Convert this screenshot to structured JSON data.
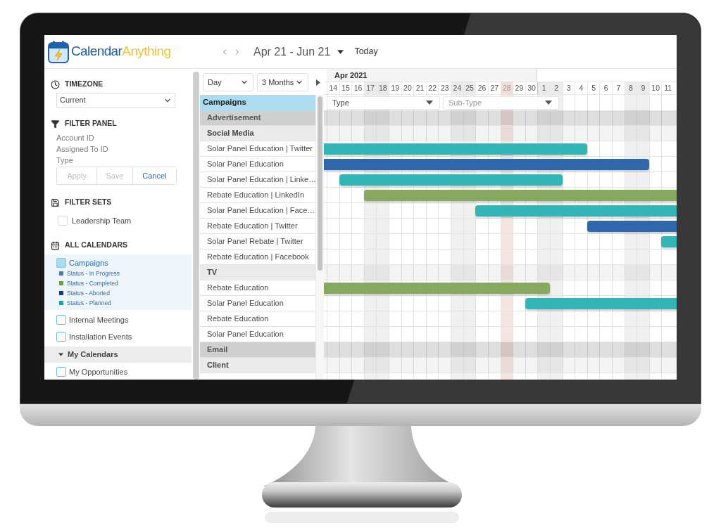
{
  "header": {
    "logo": [
      "Calendar",
      "Anything"
    ],
    "date_range": "Apr 21 - Jun 21",
    "today_button": "Today"
  },
  "sidebar": {
    "timezone": {
      "heading": "TIMEZONE",
      "value": "Current"
    },
    "filter_panel": {
      "heading": "FILTER PANEL",
      "fields": [
        "Account ID",
        "Assigned To ID",
        "Type"
      ],
      "buttons": [
        {
          "label": "Apply",
          "disabled": true
        },
        {
          "label": "Save",
          "disabled": true
        },
        {
          "label": "Cancel",
          "disabled": false
        }
      ]
    },
    "filter_sets": {
      "heading": "FILTER SETS",
      "items": [
        {
          "label": "Leadership Team",
          "checked": false
        }
      ]
    },
    "all_calendars": {
      "heading": "ALL CALENDARS",
      "items": [
        {
          "label": "Campaigns",
          "checked": true,
          "legend": [
            {
              "label": "Status - In Progress",
              "color": "#4b79b5"
            },
            {
              "label": "Status - Completed",
              "color": "#6f9a3f"
            },
            {
              "label": "Status - Aborted",
              "color": "#0e3d8a"
            },
            {
              "label": "Status - Planned",
              "color": "#16a5a5"
            }
          ]
        },
        {
          "label": "Internal Meetings",
          "checked": false
        },
        {
          "label": "Installation Events",
          "checked": false
        }
      ],
      "groups": [
        {
          "label": "My Calendars",
          "expanded": true,
          "items": [
            {
              "label": "My Opportunities",
              "checked": false
            }
          ]
        }
      ]
    }
  },
  "calendar_list": {
    "view": "Day",
    "range": "3 Months",
    "tree": {
      "label": "Campaigns",
      "children": [
        {
          "label": "Advertisement",
          "kind": "group",
          "children": [
            {
              "label": "Social Media",
              "kind": "group",
              "children": [
                {
                  "label": "Solar Panel Education | Twitter",
                  "kind": "campaign",
                  "bar": {
                    "color": "#33b5b6",
                    "continues_before": true,
                    "continues_after": false
                  }
                },
                {
                  "label": "Solar Panel Education",
                  "kind": "campaign",
                  "bar": {
                    "color": "#2f68aa",
                    "continues_before": true,
                    "continues_after": false
                  }
                },
                {
                  "label": "Solar Panel Education | Linke…",
                  "kind": "campaign",
                  "bar": {
                    "color": "#33b5b6",
                    "continues_before": false,
                    "continues_after": false
                  }
                },
                {
                  "label": "Rebate Education | LinkedIn",
                  "kind": "campaign",
                  "bar": {
                    "color": "#86a95f",
                    "continues_before": false,
                    "continues_after": true
                  }
                },
                {
                  "label": "Solar Panel Education | Face…",
                  "kind": "campaign",
                  "bar": {
                    "color": "#33b5b6",
                    "continues_before": false,
                    "continues_after": true
                  }
                },
                {
                  "label": "Rebate Education | Twitter",
                  "kind": "campaign",
                  "bar": {
                    "color": "#2f68aa",
                    "continues_before": false,
                    "continues_after": true
                  }
                },
                {
                  "label": "Solar Panel Rebate | Twitter",
                  "kind": "campaign",
                  "bar": {
                    "color": "#33b5b6",
                    "continues_before": false,
                    "continues_after": true
                  }
                },
                {
                  "label": "Rebate Education | Facebook",
                  "kind": "campaign"
                }
              ]
            },
            {
              "label": "TV",
              "kind": "group",
              "children": [
                {
                  "label": "Rebate Education",
                  "kind": "campaign",
                  "bar": {
                    "color": "#86a95f",
                    "continues_before": true,
                    "continues_after": false
                  }
                },
                {
                  "label": "Solar Panel Education",
                  "kind": "campaign",
                  "bar": {
                    "color": "#33b5b6",
                    "continues_before": false,
                    "continues_after": true
                  }
                },
                {
                  "label": "Rebate Education",
                  "kind": "campaign"
                },
                {
                  "label": "Solar Panel Education",
                  "kind": "campaign"
                }
              ]
            }
          ]
        },
        {
          "label": "Email",
          "kind": "group",
          "children": [
            {
              "label": "Client",
              "kind": "group"
            }
          ]
        }
      ]
    }
  },
  "gantt": {
    "month": "Apr 2021",
    "days": [
      {
        "label": "14",
        "weekend": false,
        "today": false,
        "month_start": false
      },
      {
        "label": "15",
        "weekend": false,
        "today": false,
        "month_start": false
      },
      {
        "label": "16",
        "weekend": false,
        "today": false,
        "month_start": false
      },
      {
        "label": "17",
        "weekend": true,
        "today": false,
        "month_start": false
      },
      {
        "label": "18",
        "weekend": true,
        "today": false,
        "month_start": false
      },
      {
        "label": "19",
        "weekend": false,
        "today": false,
        "month_start": false
      },
      {
        "label": "20",
        "weekend": false,
        "today": false,
        "month_start": false
      },
      {
        "label": "21",
        "weekend": false,
        "today": false,
        "month_start": false
      },
      {
        "label": "22",
        "weekend": false,
        "today": false,
        "month_start": false
      },
      {
        "label": "23",
        "weekend": false,
        "today": false,
        "month_start": false
      },
      {
        "label": "24",
        "weekend": true,
        "today": false,
        "month_start": false
      },
      {
        "label": "25",
        "weekend": true,
        "today": false,
        "month_start": false
      },
      {
        "label": "26",
        "weekend": false,
        "today": false,
        "month_start": false
      },
      {
        "label": "27",
        "weekend": false,
        "today": false,
        "month_start": false
      },
      {
        "label": "28",
        "weekend": false,
        "today": true,
        "month_start": false
      },
      {
        "label": "29",
        "weekend": false,
        "today": false,
        "month_start": false
      },
      {
        "label": "30",
        "weekend": false,
        "today": false,
        "month_start": false
      },
      {
        "label": "1",
        "weekend": true,
        "today": false,
        "month_start": true
      },
      {
        "label": "2",
        "weekend": true,
        "today": false,
        "month_start": false
      },
      {
        "label": "3",
        "weekend": false,
        "today": false,
        "month_start": false
      },
      {
        "label": "4",
        "weekend": false,
        "today": false,
        "month_start": false
      },
      {
        "label": "5",
        "weekend": false,
        "today": false,
        "month_start": false
      },
      {
        "label": "6",
        "weekend": false,
        "today": false,
        "month_start": false
      },
      {
        "label": "7",
        "weekend": false,
        "today": false,
        "month_start": false
      },
      {
        "label": "8",
        "weekend": true,
        "today": false,
        "month_start": false
      },
      {
        "label": "9",
        "weekend": true,
        "today": false,
        "month_start": false
      },
      {
        "label": "10",
        "weekend": false,
        "today": false,
        "month_start": false
      },
      {
        "label": "11",
        "weekend": false,
        "today": false,
        "month_start": false
      }
    ],
    "filters": [
      {
        "value": "Type"
      },
      {
        "placeholder": "Sub-Type"
      }
    ]
  }
}
